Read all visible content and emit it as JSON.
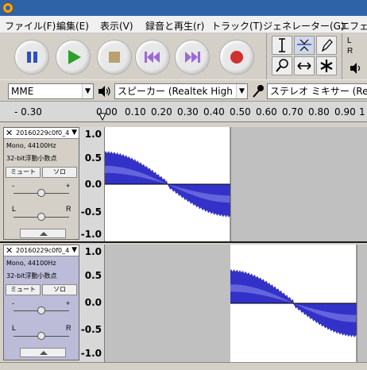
{
  "menu": [
    "ファイル(F)",
    "編集(E)",
    "表示(V)",
    "録音と再生(r)",
    "トラック(T)",
    "ジェネレーター(G)",
    "エフェク"
  ],
  "meter": {
    "left": "L",
    "right": "R"
  },
  "device": {
    "host": "MME",
    "output": "スピーカー (Realtek High Def",
    "input": "ステレオ ミキサー (Realtek"
  },
  "ruler": [
    "- 0.30",
    "0.00",
    "0.10",
    "0.20",
    "0.30",
    "0.40",
    "0.50",
    "0.60",
    "0.70",
    "0.80",
    "0.90",
    "1"
  ],
  "vruler": [
    "1.0",
    "0.5",
    "0.0",
    "-0.5",
    "-1.0"
  ],
  "tracks": [
    {
      "name": "20160229c0f0_4",
      "format": "Mono, 44100Hz",
      "bits": "32-bit浮動小数点",
      "mute": "ミュート",
      "solo": "ソロ",
      "gain_minus": "-",
      "gain_plus": "+",
      "pan_left": "L",
      "pan_right": "R",
      "clip_start": 0.0,
      "clip_end": 0.48
    },
    {
      "name": "20160229c0f0_4",
      "format": "Mono, 44100Hz",
      "bits": "32-bit浮動小数点",
      "mute": "ミュート",
      "solo": "ソロ",
      "gain_minus": "-",
      "gain_plus": "+",
      "pan_left": "L",
      "pan_right": "R",
      "clip_start": 0.48,
      "clip_end": 0.96
    }
  ],
  "colors": {
    "waveform": "#3232c8",
    "waveform_rms": "#6464dc",
    "clip_background": "#ffffff",
    "empty_background": "#c0c0c0"
  }
}
